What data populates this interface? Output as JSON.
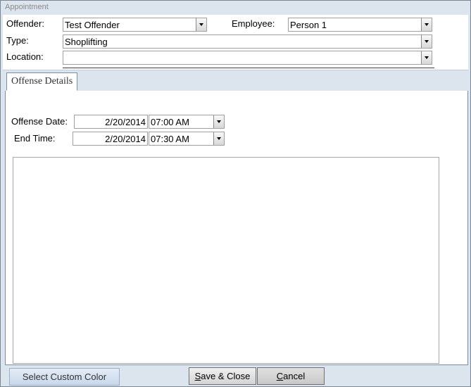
{
  "window": {
    "title": "Appointment"
  },
  "form": {
    "offender": {
      "label": "Offender:",
      "value": "Test Offender"
    },
    "employee": {
      "label": "Employee:",
      "value": "Person 1"
    },
    "type": {
      "label": "Type:",
      "value": "Shoplifting"
    },
    "location": {
      "label": "Location:",
      "value": ""
    }
  },
  "tabs": [
    {
      "label": "Offense Details",
      "active": true
    }
  ],
  "offense": {
    "date_label": "Offense Date:",
    "date_value": "2/20/2014",
    "start_time": "07:00 AM",
    "end_label": "End Time:",
    "end_date_value": "2/20/2014",
    "end_time": "07:30 AM"
  },
  "notes": {
    "value": ""
  },
  "buttons": {
    "custom_color": "Select Custom Color",
    "save_close_underline": "S",
    "save_close_rest": "ave & Close",
    "cancel_underline": "C",
    "cancel_rest": "ancel"
  },
  "icons": {
    "dropdown": "chevron-down-icon"
  },
  "colors": {
    "window_bg": "#dce4ee",
    "tab_border": "#7a8ea8"
  }
}
